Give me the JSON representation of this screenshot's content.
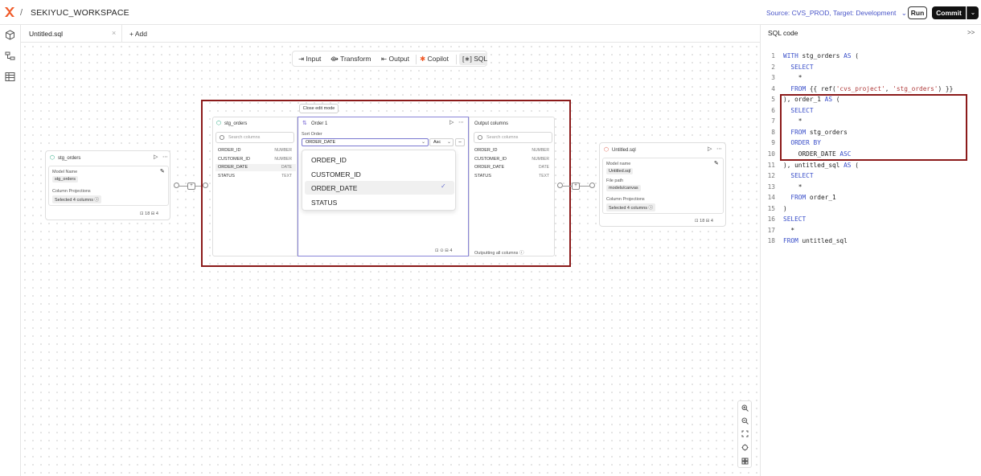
{
  "header": {
    "separator": "/",
    "workspace": "SEKIYUC_WORKSPACE",
    "source_target": "Source: CVS_PROD, Target: Development",
    "source_chevron": "⌄",
    "run_label": "Run",
    "commit_label": "Commit",
    "commit_dropdown": "⌄"
  },
  "tabs": {
    "active": "Untitled.sql",
    "close": "×",
    "add": "+  Add"
  },
  "toolbar": {
    "input": "Input",
    "transform": "Transform",
    "output": "Output",
    "copilot": "Copilot",
    "sql": "SQL"
  },
  "source_node": {
    "title": "stg_orders",
    "model_name_label": "Model Name",
    "model_name": "stg_orders",
    "projections_label": "Column Projections",
    "projections_value": "Selected 4 columns ⓘ",
    "footer": "⊡ 18   ⊟ 4"
  },
  "edit": {
    "close_label": "Close edit mode",
    "input_panel": {
      "title": "stg_orders",
      "search_placeholder": "Search columns",
      "columns": [
        {
          "name": "ORDER_ID",
          "type": "NUMBER"
        },
        {
          "name": "CUSTOMER_ID",
          "type": "NUMBER"
        },
        {
          "name": "ORDER_DATE",
          "type": "DATE"
        },
        {
          "name": "STATUS",
          "type": "TEXT"
        }
      ]
    },
    "order_panel": {
      "title": "Order 1",
      "sort_label": "Sort Order",
      "sort_column": "ORDER_DATE",
      "direction": "Asc",
      "footer": "⊡ ⊙  ⊟ 4"
    },
    "dropdown_options": [
      "ORDER_ID",
      "CUSTOMER_ID",
      "ORDER_DATE",
      "STATUS"
    ],
    "dropdown_selected": "ORDER_DATE",
    "output_panel": {
      "title": "Output columns",
      "search_placeholder": "Search columns",
      "columns": [
        {
          "name": "ORDER_ID",
          "type": "NUMBER"
        },
        {
          "name": "CUSTOMER_ID",
          "type": "NUMBER"
        },
        {
          "name": "ORDER_DATE",
          "type": "DATE"
        },
        {
          "name": "STATUS",
          "type": "TEXT"
        }
      ],
      "footer": "Outputting all columns ⓘ"
    }
  },
  "target_node": {
    "title": "Untitled.sql",
    "model_name_label": "Model name",
    "model_name": "Untitled.sql",
    "file_path_label": "File path",
    "file_path": "models/canvas",
    "projections_label": "Column Projections",
    "projections_value": "Selected 4 columns ⓘ",
    "footer": "⊡ 18   ⊟ 4"
  },
  "sql_panel": {
    "title": "SQL code",
    "collapse": ">>",
    "lines": [
      {
        "n": "1",
        "html": "<span class='kw'>WITH</span> stg_orders <span class='kw'>AS</span> ("
      },
      {
        "n": "2",
        "html": "  <span class='kw'>SELECT</span>"
      },
      {
        "n": "3",
        "html": "    *"
      },
      {
        "n": "4",
        "html": "  <span class='kw'>FROM</span> {{ ref(<span class='st'>'cvs_project'</span>, <span class='st'>'stg_orders'</span>) }}"
      },
      {
        "n": "5",
        "html": "), order_1 <span class='kw'>AS</span> ("
      },
      {
        "n": "6",
        "html": "  <span class='kw'>SELECT</span>"
      },
      {
        "n": "7",
        "html": "    *"
      },
      {
        "n": "8",
        "html": "  <span class='kw'>FROM</span> stg_orders"
      },
      {
        "n": "9",
        "html": "  <span class='kw'>ORDER BY</span>"
      },
      {
        "n": "10",
        "html": "    ORDER_DATE <span class='kw'>ASC</span>"
      },
      {
        "n": "11",
        "html": "), untitled_sql <span class='kw'>AS</span> ("
      },
      {
        "n": "12",
        "html": "  <span class='kw'>SELECT</span>"
      },
      {
        "n": "13",
        "html": "    *"
      },
      {
        "n": "14",
        "html": "  <span class='kw'>FROM</span> order_1"
      },
      {
        "n": "15",
        "html": ")"
      },
      {
        "n": "16",
        "html": "<span class='kw'>SELECT</span>"
      },
      {
        "n": "17",
        "html": "  *"
      },
      {
        "n": "18",
        "html": "<span class='kw'>FROM</span> untitled_sql"
      }
    ]
  },
  "colors": {
    "accent": "#3a4fc9",
    "highlight_border": "#8b1a1a",
    "order_panel_border": "#8a86d8"
  }
}
